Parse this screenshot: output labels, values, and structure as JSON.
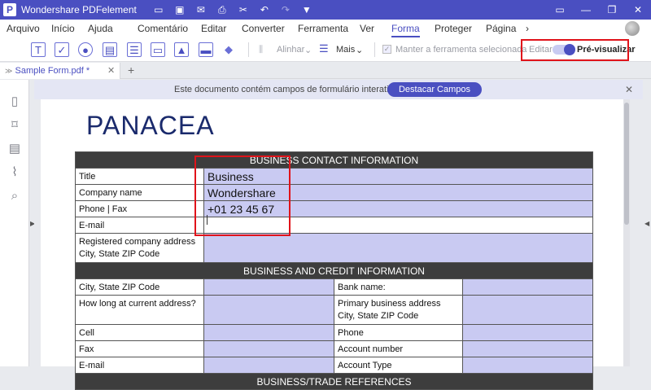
{
  "titlebar": {
    "title": "Wondershare PDFelement"
  },
  "menubar": {
    "items": [
      "Arquivo",
      "Início",
      "Ajuda",
      "Comentário",
      "Editar",
      "Converter",
      "Ferramenta",
      "Ver",
      "Forma",
      "Proteger",
      "Página"
    ],
    "active": "Forma"
  },
  "toolbar": {
    "align_label": "Alinhar",
    "more_label": "Mais",
    "keep_tool_label": "Manter a ferramenta selecionada",
    "edit_label": "Editar",
    "preview_label": "Pré-visualizar"
  },
  "tabs": [
    {
      "label": "Sample Form.pdf *"
    }
  ],
  "banner": {
    "message": "Este documento contém campos de formulário interativos.",
    "button": "Destacar Campos"
  },
  "document": {
    "logo": "PANACEA",
    "section1_title": "BUSINESS CONTACT INFORMATION",
    "section1_rows": [
      {
        "label": "Title",
        "value": "Business"
      },
      {
        "label": "Company name",
        "value": "Wondershare"
      },
      {
        "label": "Phone | Fax",
        "value": "+01 23 45 67"
      },
      {
        "label": "E-mail",
        "value": ""
      },
      {
        "label": "Registered company address",
        "label2": "City, State ZIP Code",
        "value": ""
      }
    ],
    "section2_title": "BUSINESS AND CREDIT INFORMATION",
    "section2_rows": [
      {
        "left": "City, State ZIP Code",
        "right": "Bank name:"
      },
      {
        "left": "How long at current address?",
        "right": "Primary business address",
        "right2": "City, State ZIP Code"
      },
      {
        "left": "Cell",
        "right": "Phone"
      },
      {
        "left": "Fax",
        "right": "Account number"
      },
      {
        "left": "E-mail",
        "right": "Account Type"
      }
    ],
    "section3_title": "BUSINESS/TRADE REFERENCES"
  },
  "colors": {
    "accent": "#4a4fc1",
    "field_fill": "#c9caf2",
    "highlight_box": "#e0131a",
    "header_bg": "#3d3d3d"
  }
}
